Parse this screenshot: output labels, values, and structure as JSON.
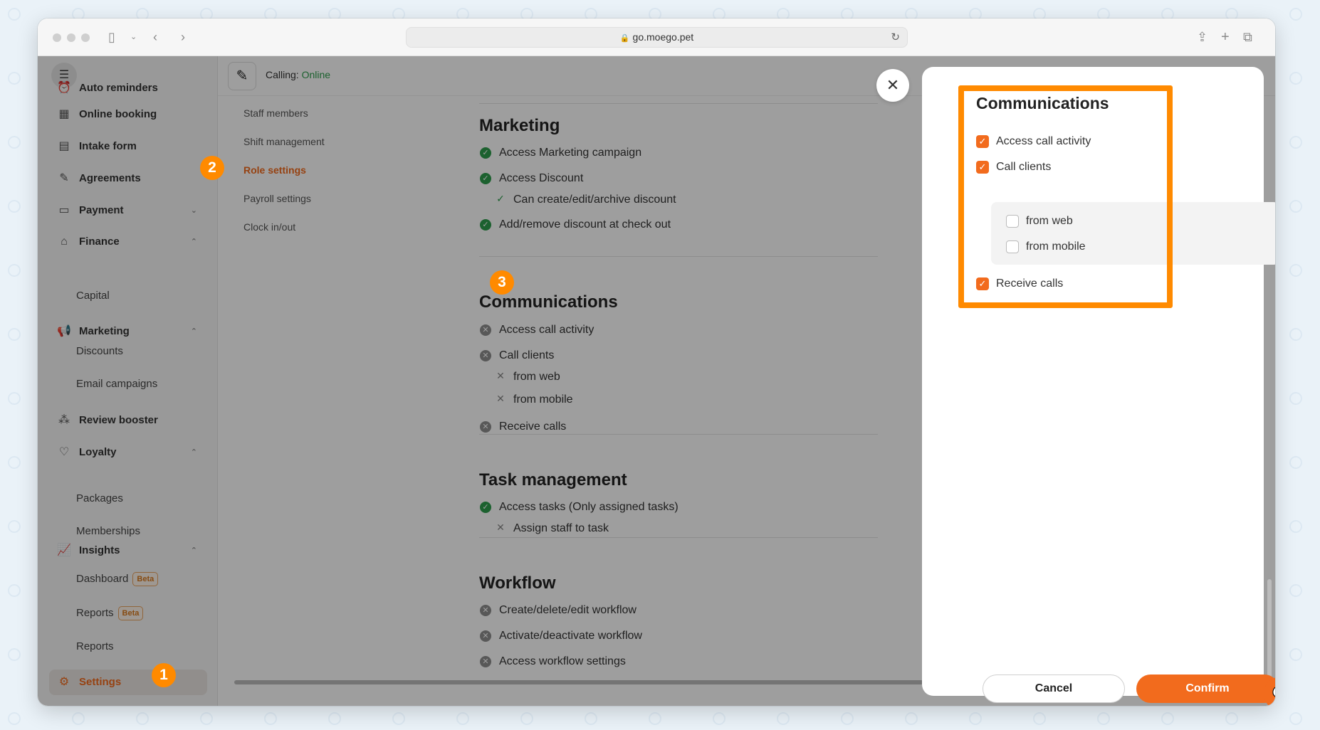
{
  "browser": {
    "url": "go.moego.pet"
  },
  "topbar": {
    "calling_label": "Calling:",
    "calling_status": "Online"
  },
  "sidebar": {
    "items": [
      {
        "label": "Auto reminders"
      },
      {
        "label": "Online booking"
      },
      {
        "label": "Intake form"
      },
      {
        "label": "Agreements"
      },
      {
        "label": "Payment"
      },
      {
        "label": "Finance"
      },
      {
        "label": "Capital"
      },
      {
        "label": "Marketing"
      },
      {
        "label": "Discounts"
      },
      {
        "label": "Email campaigns"
      },
      {
        "label": "Review booster"
      },
      {
        "label": "Loyalty"
      },
      {
        "label": "Packages"
      },
      {
        "label": "Memberships"
      },
      {
        "label": "Insights"
      },
      {
        "label": "Dashboard",
        "badge": "Beta"
      },
      {
        "label": "Reports",
        "badge": "Beta"
      },
      {
        "label": "Reports"
      },
      {
        "label": "Settings"
      }
    ]
  },
  "subnav": {
    "items": [
      "Staff members",
      "Shift management",
      "Role settings",
      "Payroll settings",
      "Clock in/out"
    ]
  },
  "main": {
    "marketing": {
      "title": "Marketing",
      "perms": [
        "Access Marketing campaign",
        "Access Discount",
        "Can create/edit/archive discount",
        "Add/remove discount at check out"
      ]
    },
    "communications": {
      "title": "Communications",
      "perms": [
        "Access call activity",
        "Call clients",
        "from web",
        "from mobile",
        "Receive calls"
      ]
    },
    "task_management": {
      "title": "Task management",
      "perms": [
        "Access tasks (Only assigned tasks)",
        "Assign staff to task"
      ]
    },
    "workflow": {
      "title": "Workflow",
      "perms": [
        "Create/delete/edit workflow",
        "Activate/deactivate workflow",
        "Access workflow settings"
      ]
    }
  },
  "drawer": {
    "title": "Communications",
    "options": [
      {
        "label": "Access call activity",
        "checked": true
      },
      {
        "label": "Call clients",
        "checked": true
      },
      {
        "label": "from web",
        "checked": false
      },
      {
        "label": "from mobile",
        "checked": false
      },
      {
        "label": "Receive calls",
        "checked": true
      }
    ],
    "cancel_label": "Cancel",
    "confirm_label": "Confirm"
  },
  "badges": [
    "1",
    "2",
    "3"
  ],
  "colors": {
    "accent": "#f26b1d",
    "highlight": "#ff8a00",
    "success": "#2e9d4c"
  }
}
